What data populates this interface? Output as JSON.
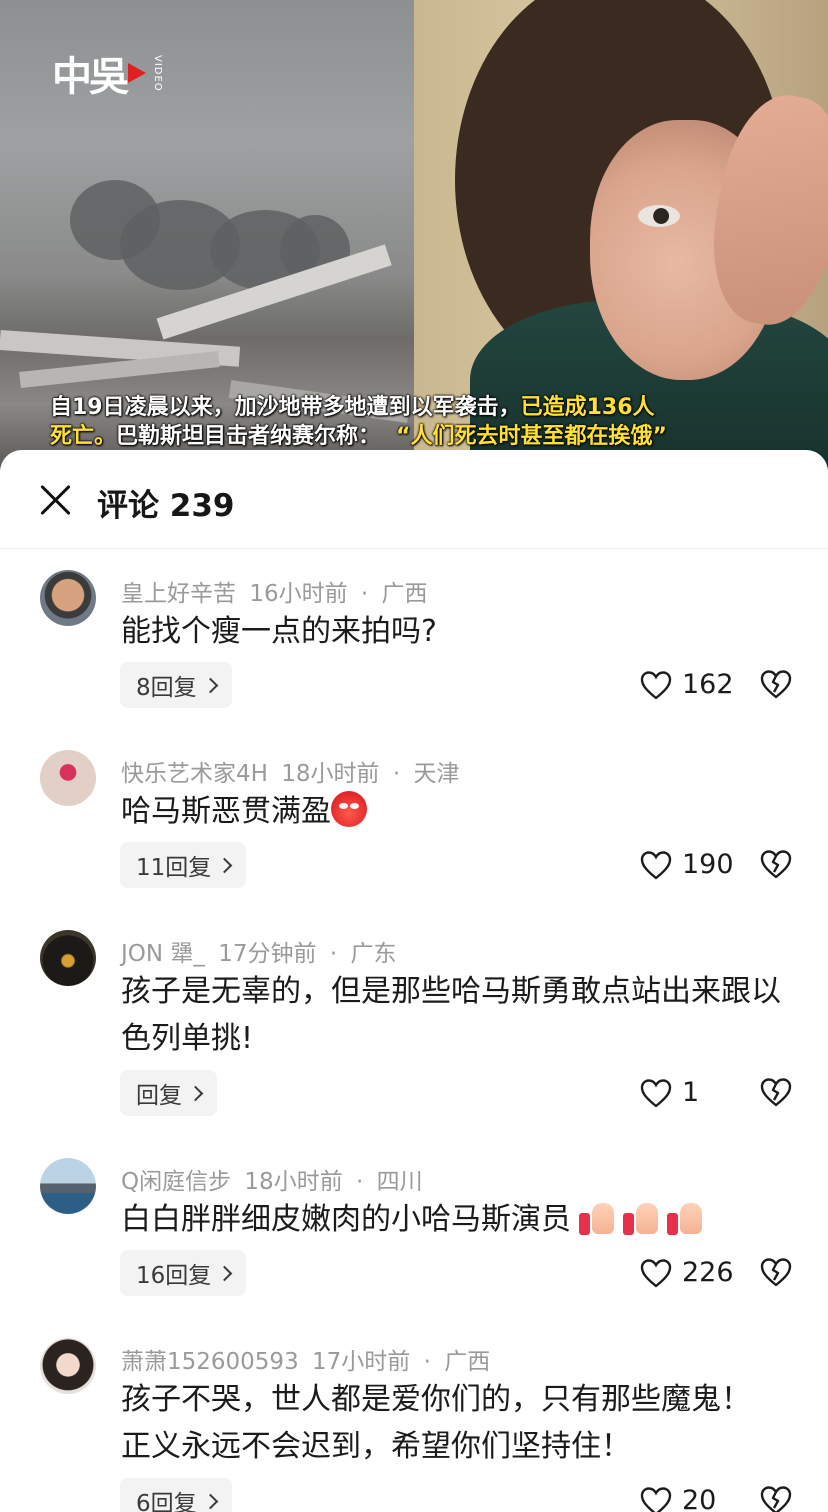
{
  "video": {
    "logo_text": "中吳",
    "logo_sub": "VIDEO",
    "caption_line1_white": "自19日凌晨以来，加沙地带多地遭到以军袭击，",
    "caption_line1_yellow": "已造成136人",
    "caption_line2_yellow": "死亡。",
    "caption_line2_white": "巴勒斯坦目击者纳赛尔称：",
    "caption_line2_quote": "“人们死去时甚至都在挨饿”"
  },
  "sheet": {
    "title": "评论 239"
  },
  "comments": [
    {
      "author": "皇上好辛苦",
      "time": "16小时前",
      "location": "广西",
      "text": "能找个瘦一点的来拍吗?",
      "replies": "8回复",
      "likes": "162"
    },
    {
      "author": "快乐艺术家4H",
      "time": "18小时前",
      "location": "天津",
      "text": "哈马斯恶贯满盈",
      "emoji": "angry-face-icon",
      "replies": "11回复",
      "likes": "190"
    },
    {
      "author": "JON 犟_",
      "time": "17分钟前",
      "location": "广东",
      "text": "孩子是无辜的，但是那些哈马斯勇敢点站出来跟以色列单挑!",
      "replies": "回复",
      "likes": "1"
    },
    {
      "author": "Q闲庭信步",
      "time": "18小时前",
      "location": "四川",
      "text": "白白胖胖细皮嫩肉的小哈马斯演员",
      "emoji": "thumbs-up-icon",
      "replies": "16回复",
      "likes": "226"
    },
    {
      "author": "萧萧152600593",
      "time": "17小时前",
      "location": "广西",
      "text": "孩子不哭，世人都是爱你们的，只有那些魔鬼！正义永远不会迟到，希望你们坚持住！",
      "replies": "6回复",
      "likes": "20"
    }
  ],
  "colors": {
    "caption_highlight": "#ffe033",
    "meta_gray": "#9a9a9a",
    "reply_bg": "#f3f3f3"
  }
}
